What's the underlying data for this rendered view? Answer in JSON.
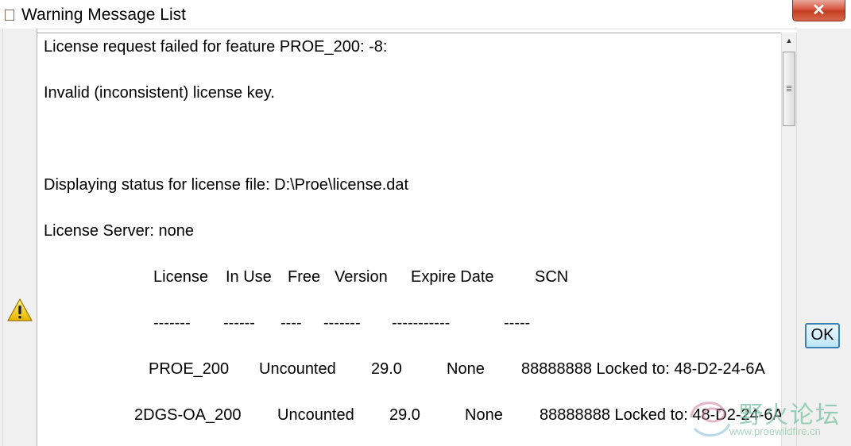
{
  "window": {
    "title": "Warning Message List",
    "close_label": "✕"
  },
  "messages": [
    "License request failed for feature PROE_200: -8:",
    "Invalid (inconsistent) license key.",
    "Displaying status for license file: D:\\Proe\\license.dat",
    "License Server: none"
  ],
  "table": {
    "headers": [
      "License",
      "In Use",
      "Free",
      "Version",
      "Expire Date",
      "SCN"
    ],
    "separators": [
      "-------",
      "------",
      "----",
      "-------",
      "-----------",
      "-----"
    ],
    "rows": [
      [
        "PROE_200",
        "Uncounted",
        "29.0",
        "None",
        "88888888 Locked to: 48-D2-24-6A"
      ],
      [
        "2DGS-OA_200",
        "Uncounted",
        "29.0",
        "None",
        "88888888 Locked to: 48-D2-24-6A"
      ]
    ]
  },
  "buttons": {
    "ok_label": "OK"
  },
  "icons": {
    "warning": "warning-icon",
    "title": "window-icon",
    "close": "close-icon"
  },
  "watermark": {
    "name": "野火论坛",
    "url": "www.proewildfire.cn"
  }
}
